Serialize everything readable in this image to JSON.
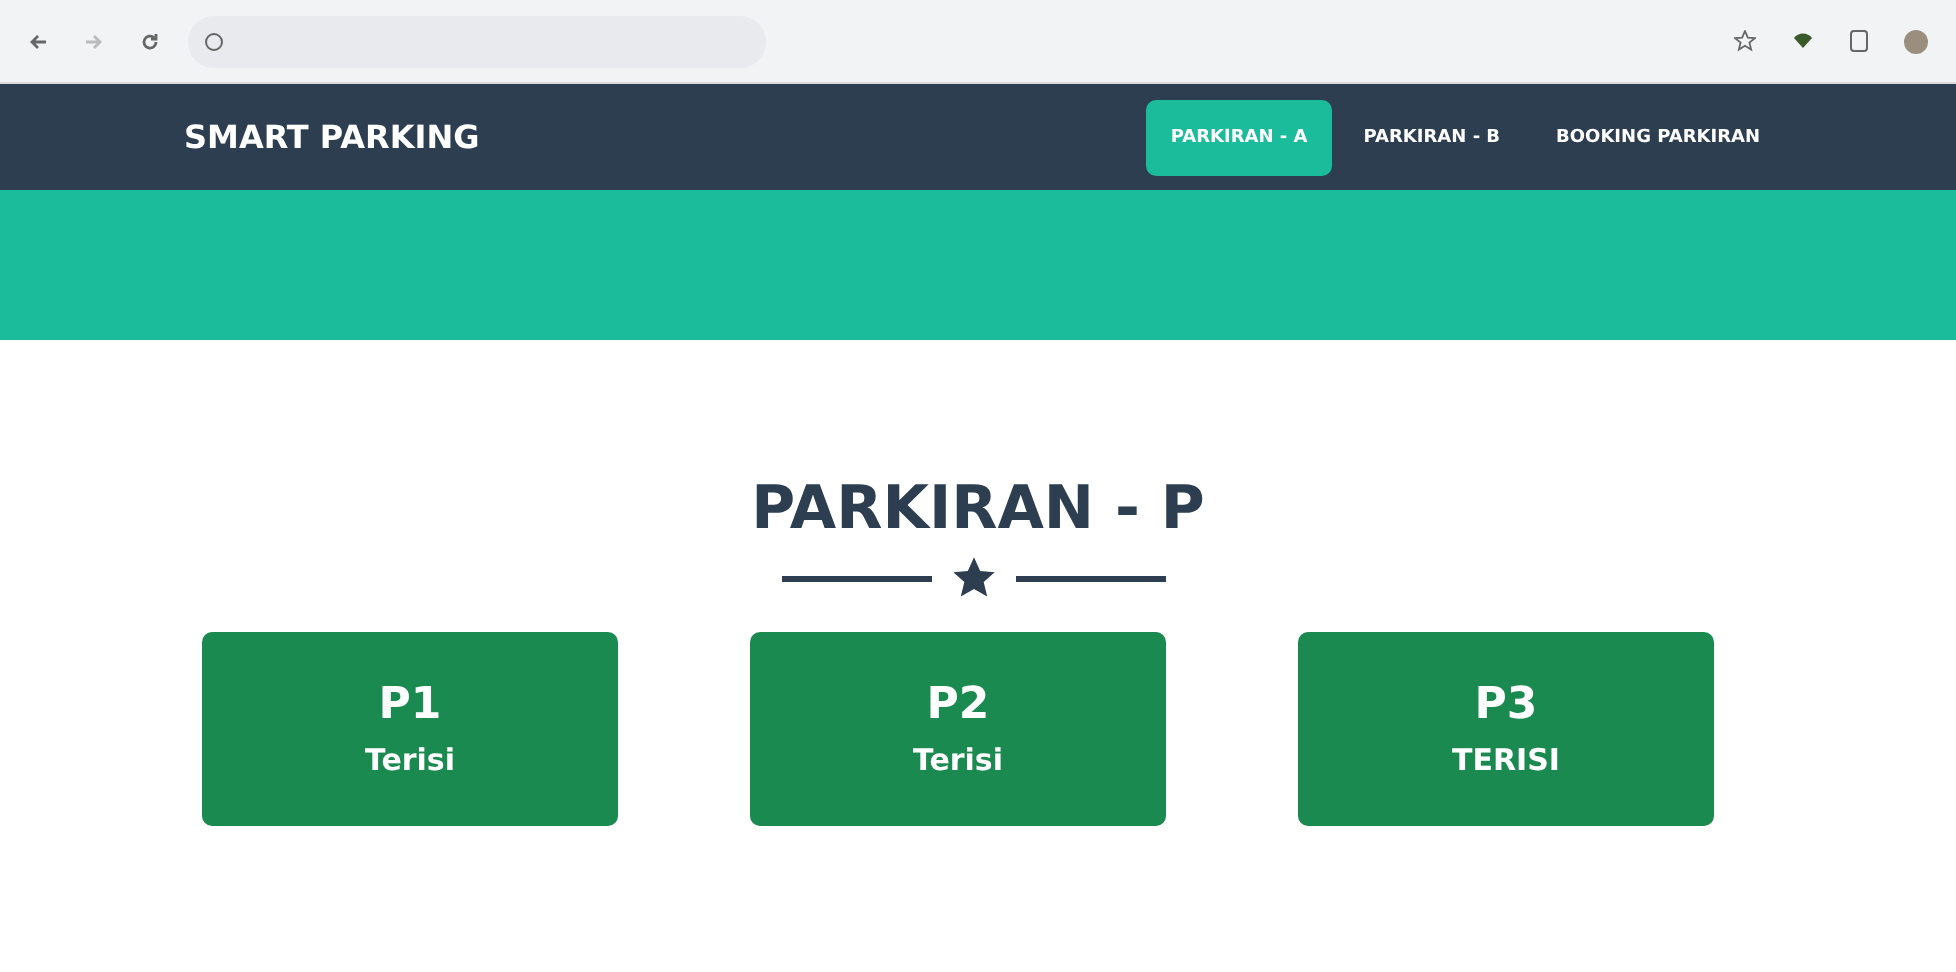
{
  "brand": "SMART PARKING",
  "nav": [
    {
      "label": "PARKIRAN - A",
      "selected": true
    },
    {
      "label": "PARKIRAN - B",
      "selected": false
    },
    {
      "label": "BOOKING PARKIRAN",
      "selected": false
    }
  ],
  "heading": "PARKIRAN - P",
  "slots": [
    {
      "name": "P1",
      "status": "Terisi"
    },
    {
      "name": "P2",
      "status": "Terisi"
    },
    {
      "name": "P3",
      "status": "TERISI"
    }
  ]
}
